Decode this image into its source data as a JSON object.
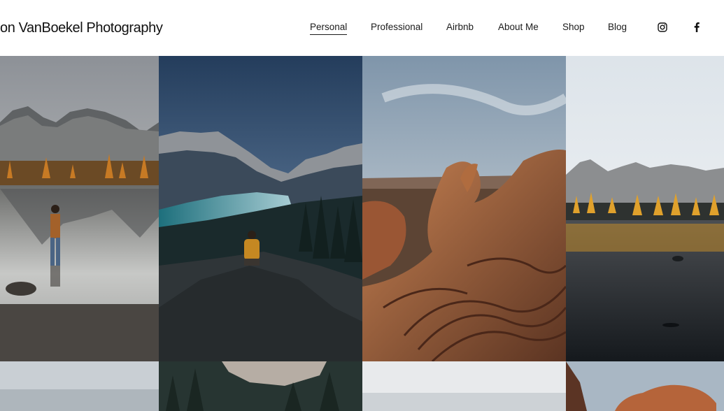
{
  "site": {
    "title": "on VanBoekel Photography"
  },
  "nav": {
    "items": [
      {
        "label": "Personal",
        "active": true
      },
      {
        "label": "Professional",
        "active": false
      },
      {
        "label": "Airbnb",
        "active": false
      },
      {
        "label": "About Me",
        "active": false
      },
      {
        "label": "Shop",
        "active": false
      },
      {
        "label": "Blog",
        "active": false
      }
    ]
  },
  "social": [
    {
      "icon": "instagram-icon"
    },
    {
      "icon": "facebook-icon"
    }
  ],
  "gallery": {
    "images": [
      {
        "subject": "mountain-lake-hiker-reflection"
      },
      {
        "subject": "turquoise-lake-night-overlook"
      },
      {
        "subject": "desert-sandstone-formations"
      },
      {
        "subject": "larch-forest-lake-reflection"
      },
      {
        "subject": "misty-valley"
      },
      {
        "subject": "forest-hillside"
      },
      {
        "subject": "overcast-sky"
      },
      {
        "subject": "red-rock-canyon"
      }
    ]
  },
  "colors": {
    "background": "#ffffff",
    "text": "#111111"
  }
}
